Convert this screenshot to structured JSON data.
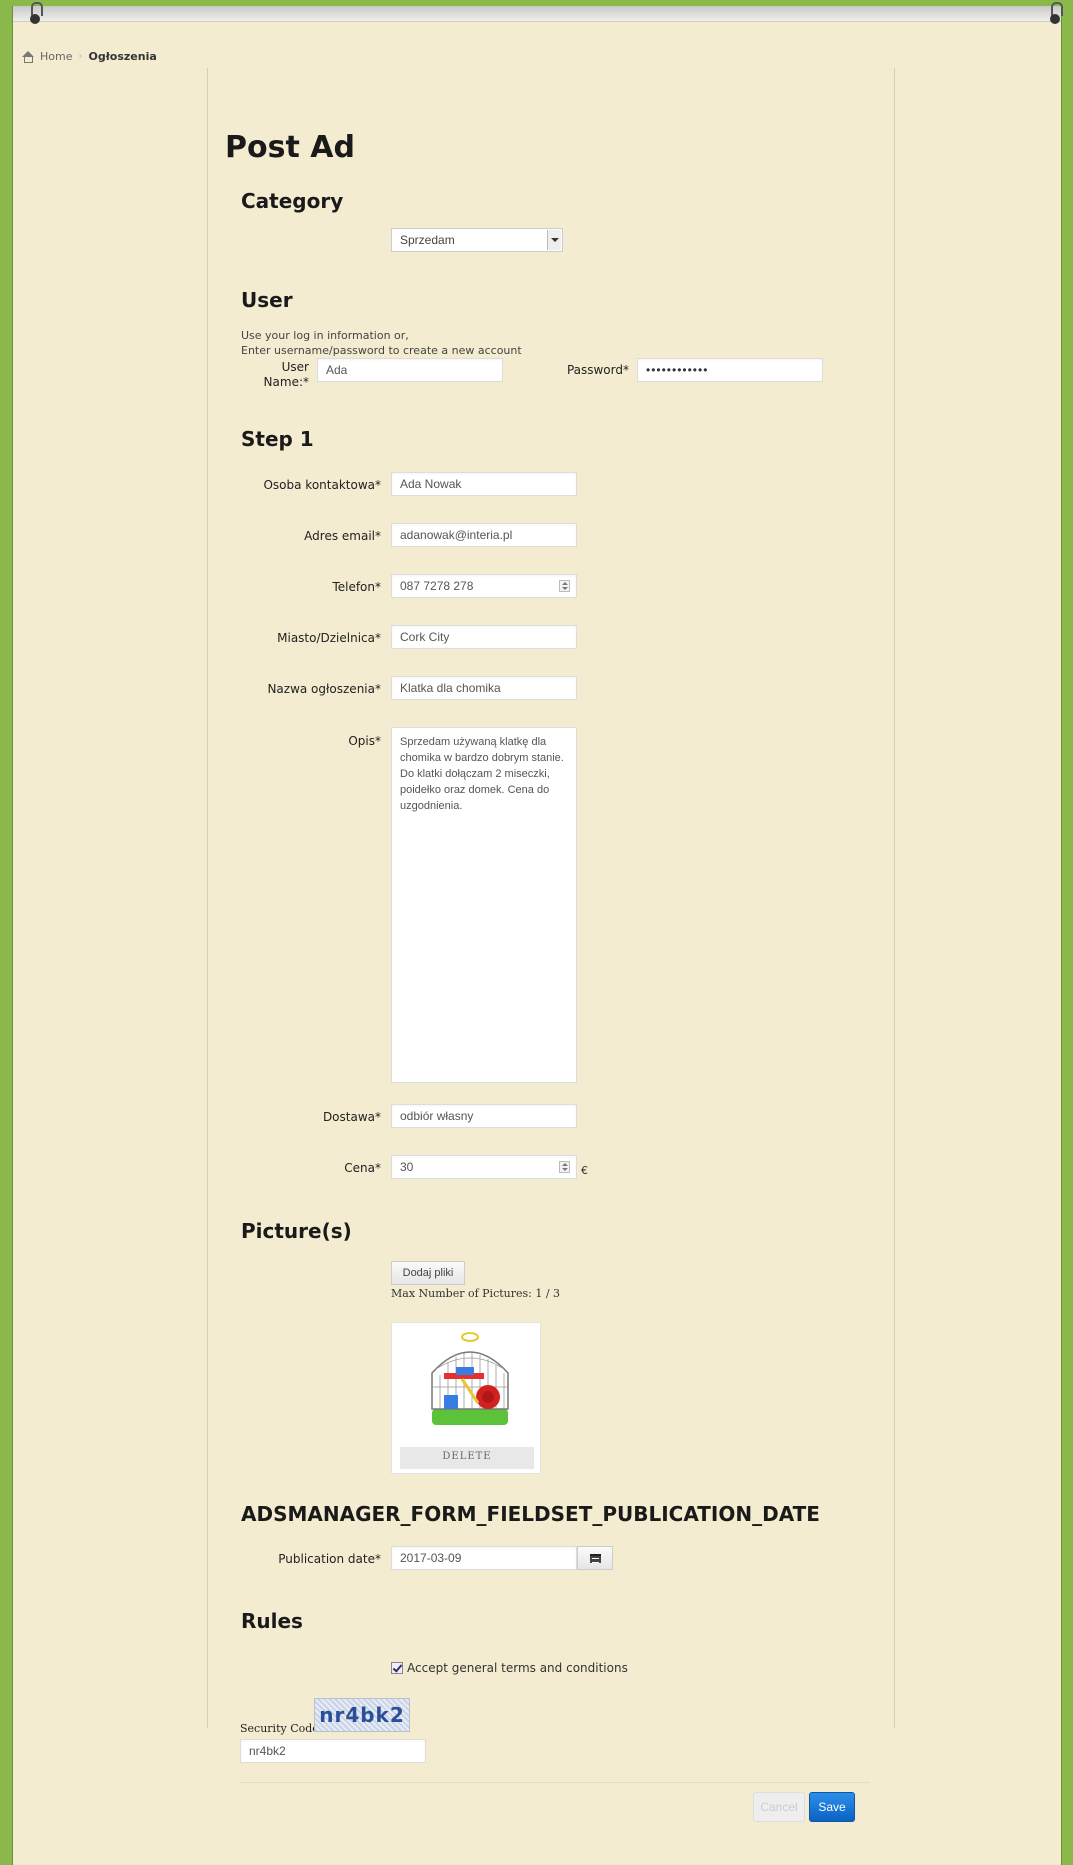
{
  "breadcrumb": {
    "home": "Home",
    "current": "Ogłoszenia"
  },
  "page_title": "Post Ad",
  "category": {
    "heading": "Category",
    "selected": "Sprzedam"
  },
  "user": {
    "heading": "User",
    "info_line1": "Use your log in information or,",
    "info_line2": "Enter username/password to create a new account",
    "username_label_line1": "User",
    "username_label_line2": "Name:*",
    "username_value": "Ada",
    "password_label": "Password*",
    "password_value": "••••••••••••"
  },
  "step1": {
    "heading": "Step 1",
    "fields": {
      "contact": {
        "label": "Osoba kontaktowa*",
        "value": "Ada Nowak"
      },
      "email": {
        "label": "Adres email*",
        "value": "adanowak@interia.pl"
      },
      "phone": {
        "label": "Telefon*",
        "value": "087 7278 278"
      },
      "city": {
        "label": "Miasto/Dzielnica*",
        "value": "Cork City"
      },
      "title": {
        "label": "Nazwa ogłoszenia*",
        "value": "Klatka dla chomika"
      },
      "description": {
        "label": "Opis*",
        "value": "Sprzedam używaną klatkę dla chomika w bardzo dobrym stanie. Do klatki dołączam 2 miseczki, poidełko oraz domek. Cena do uzgodnienia."
      },
      "delivery": {
        "label": "Dostawa*",
        "value": "odbiór własny"
      },
      "price": {
        "label": "Cena*",
        "value": "30",
        "currency": "€"
      }
    }
  },
  "pictures": {
    "heading": "Picture(s)",
    "add_button": "Dodaj pliki",
    "max_text": "Max Number of Pictures: 1 / 3",
    "delete_label": "DELETE"
  },
  "publication": {
    "heading": "ADSMANAGER_FORM_FIELDSET_PUBLICATION_DATE",
    "label": "Publication date*",
    "value": "2017-03-09"
  },
  "rules": {
    "heading": "Rules",
    "accept_label": "Accept general terms and conditions",
    "checked": true
  },
  "security": {
    "label": "Security Code",
    "captcha_text": "nr4bk2",
    "value": "nr4bk2"
  },
  "actions": {
    "cancel": "Cancel",
    "save": "Save"
  }
}
